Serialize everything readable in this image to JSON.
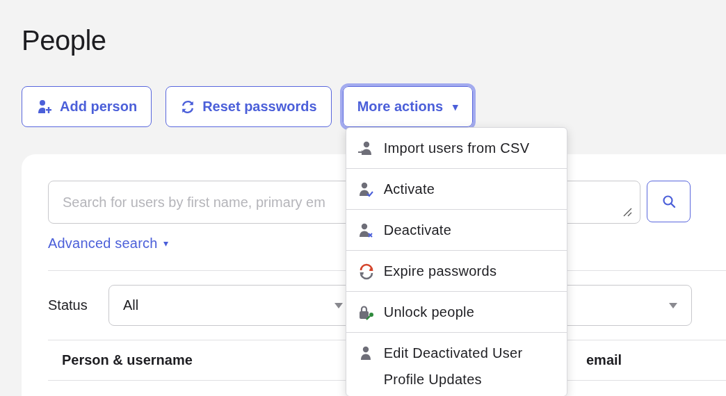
{
  "page": {
    "title": "People"
  },
  "actions": [
    {
      "kind": "add",
      "label": "Add person",
      "expanded": false
    },
    {
      "kind": "reset",
      "label": "Reset passwords",
      "expanded": false
    },
    {
      "kind": "more",
      "label": "More actions",
      "caret": "▾",
      "expanded": true
    }
  ],
  "menu": [
    {
      "kind": "import",
      "label": "Import users from CSV"
    },
    {
      "kind": "activate",
      "label": "Activate"
    },
    {
      "kind": "deactivate",
      "label": "Deactivate"
    },
    {
      "kind": "expire",
      "label": "Expire passwords"
    },
    {
      "kind": "unlock",
      "label": "Unlock people"
    },
    {
      "kind": "edit",
      "label": "Edit Deactivated User Profile Updates"
    }
  ],
  "search": {
    "placeholder": "Search for users by first name, primary em"
  },
  "advanced_search": {
    "label": "Advanced search",
    "caret": "▾"
  },
  "filters": [
    {
      "label": "Status",
      "value": "All"
    }
  ],
  "table": {
    "columns": [
      "Person & username",
      "email"
    ]
  }
}
